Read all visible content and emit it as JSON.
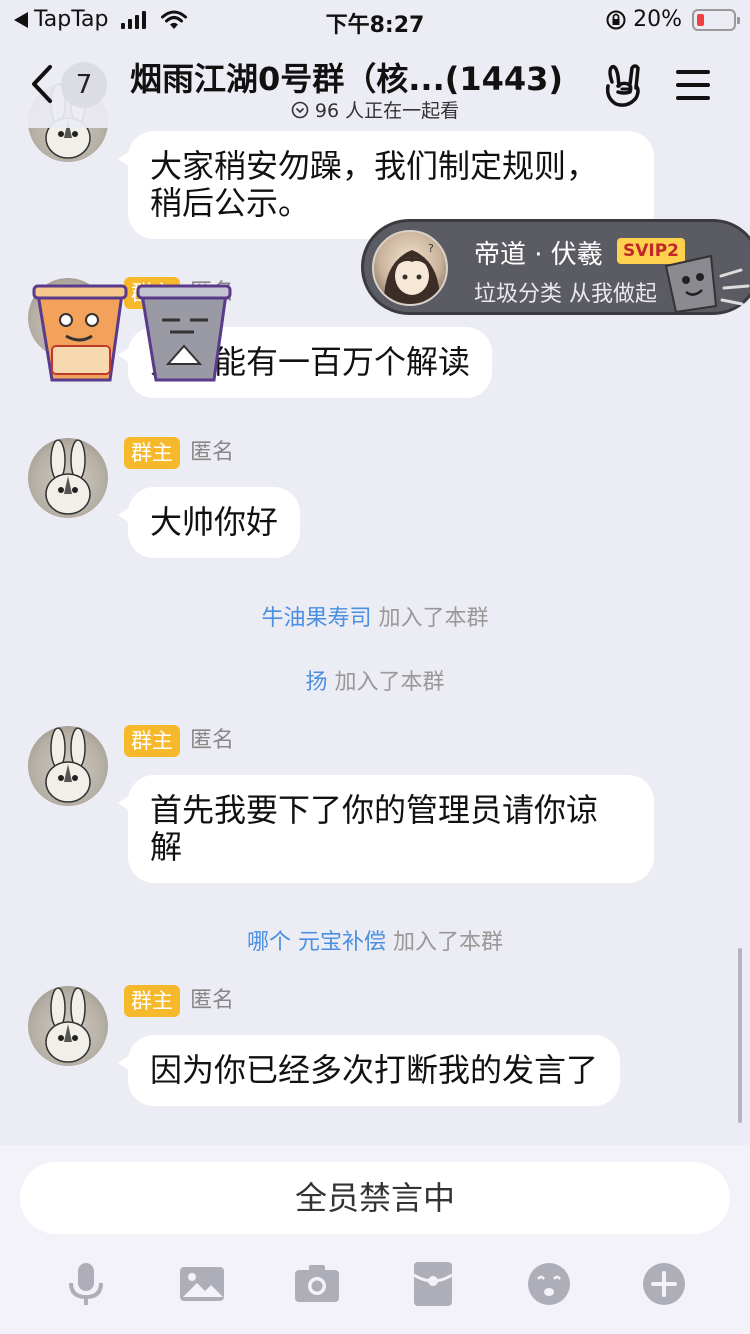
{
  "status_bar": {
    "carrier": "TapTap",
    "time": "下午8:27",
    "battery": "20%"
  },
  "header": {
    "unread_count": "7",
    "title": "烟雨江湖0号群（核...(1443)",
    "watching": "96 人正在一起看"
  },
  "vip_card": {
    "name": "帝道 · 伏羲",
    "tag": "SVIP2",
    "slogan": "垃圾分类 从我做起"
  },
  "messages": [
    {
      "text_lines": [
        "大家稍安勿躁，我们制定规则，",
        "稍后公示。"
      ]
    },
    {
      "badge": "群主",
      "sender": "匿名",
      "text_lines": [
        "人可能有一百万个解读"
      ]
    },
    {
      "badge": "群主",
      "sender": "匿名",
      "text_lines": [
        "大帅你好"
      ]
    },
    {
      "badge": "群主",
      "sender": "匿名",
      "text_lines": [
        "首先我要下了你的管理员请你谅",
        "解"
      ]
    },
    {
      "badge": "群主",
      "sender": "匿名",
      "text_lines": [
        "因为你已经多次打断我的发言了"
      ]
    }
  ],
  "system_messages": [
    {
      "nick": "牛油果寿司",
      "action": "加入了本群"
    },
    {
      "nick": "扬",
      "action": "加入了本群"
    },
    {
      "nick": "哪个 元宝补偿",
      "action": "加入了本群"
    }
  ],
  "input": {
    "muted_text": "全员禁言中"
  },
  "toolbar_icons": [
    "microphone-icon",
    "image-icon",
    "camera-icon",
    "red-packet-icon",
    "emoji-icon",
    "plus-icon"
  ],
  "colors": {
    "background": "#ececf4",
    "owner_badge": "#f6b92c",
    "nick_link": "#4a8fe0",
    "vip_tag": "#ffd24d"
  }
}
